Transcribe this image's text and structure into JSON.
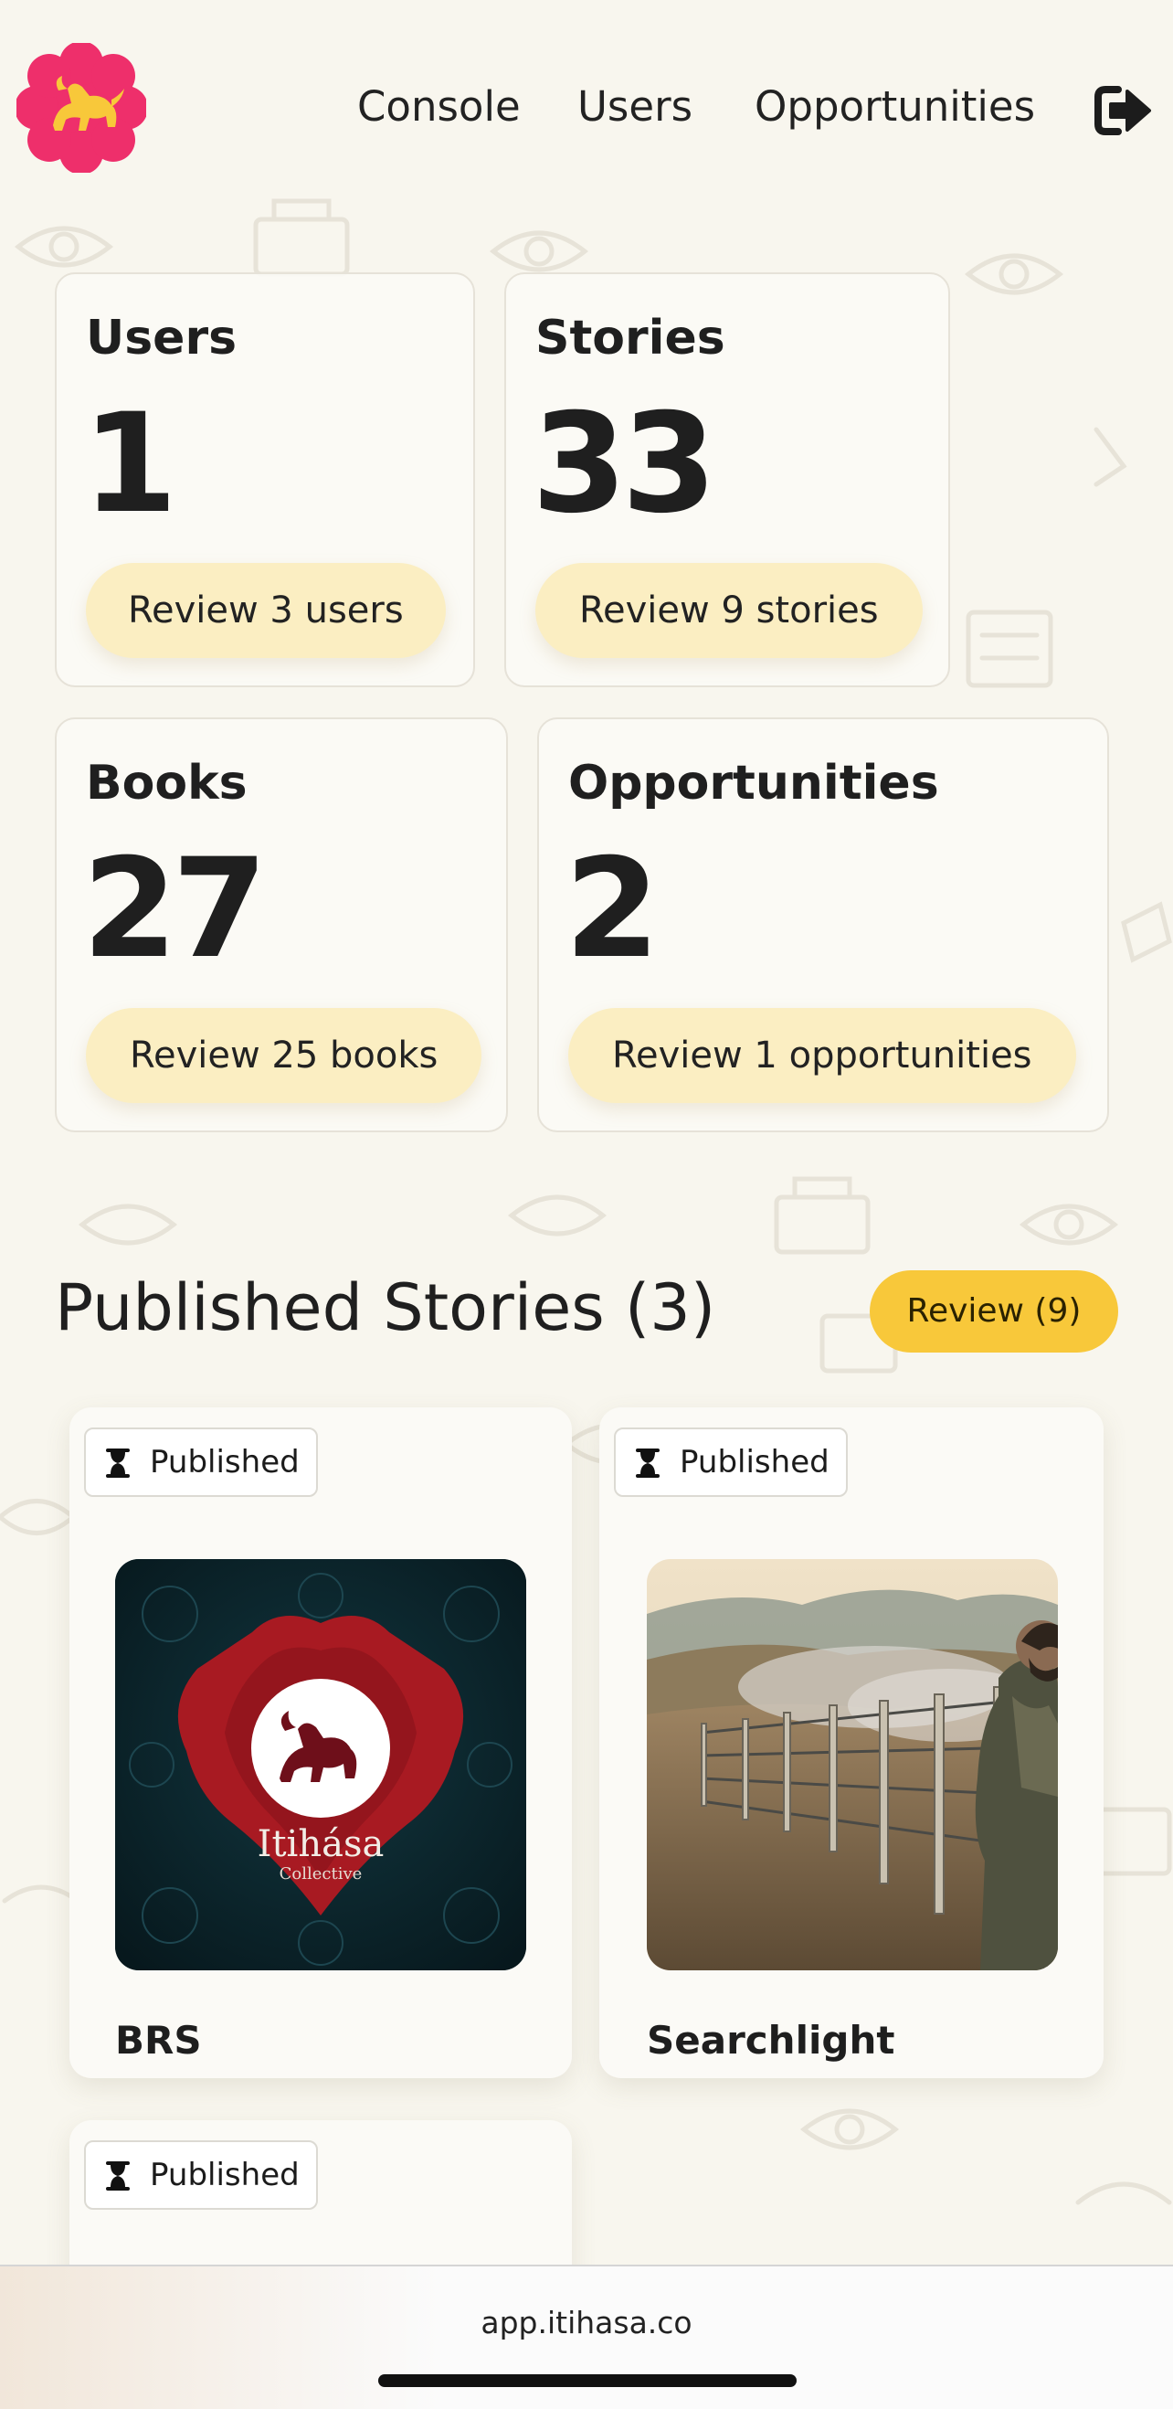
{
  "nav": {
    "links": [
      "Console",
      "Users",
      "Opportunities"
    ],
    "logo_icon": "lion-emblem-icon",
    "logout_icon": "sign-out-icon",
    "colors": {
      "logo_bg": "#ee2f6b",
      "logo_fg": "#f8c83a"
    }
  },
  "stats": [
    {
      "title": "Users",
      "count": "1",
      "action": "Review 3 users"
    },
    {
      "title": "Stories",
      "count": "33",
      "action": "Review 9 stories"
    },
    {
      "title": "Books",
      "count": "27",
      "action": "Review 25 books"
    },
    {
      "title": "Opportunities",
      "count": "2",
      "action": "Review 1 opportunities"
    }
  ],
  "published": {
    "title": "Published Stories (3)",
    "review_button": "Review (9)",
    "accent": "#f8c83a",
    "stories": [
      {
        "status": "Published",
        "title": "BRS",
        "cover": {
          "brand": "Itihása",
          "sub": "Collective"
        }
      },
      {
        "status": "Published",
        "title": "Searchlight"
      },
      {
        "status": "Published",
        "title": ""
      }
    ]
  },
  "browser": {
    "url": "app.itihasa.co"
  }
}
